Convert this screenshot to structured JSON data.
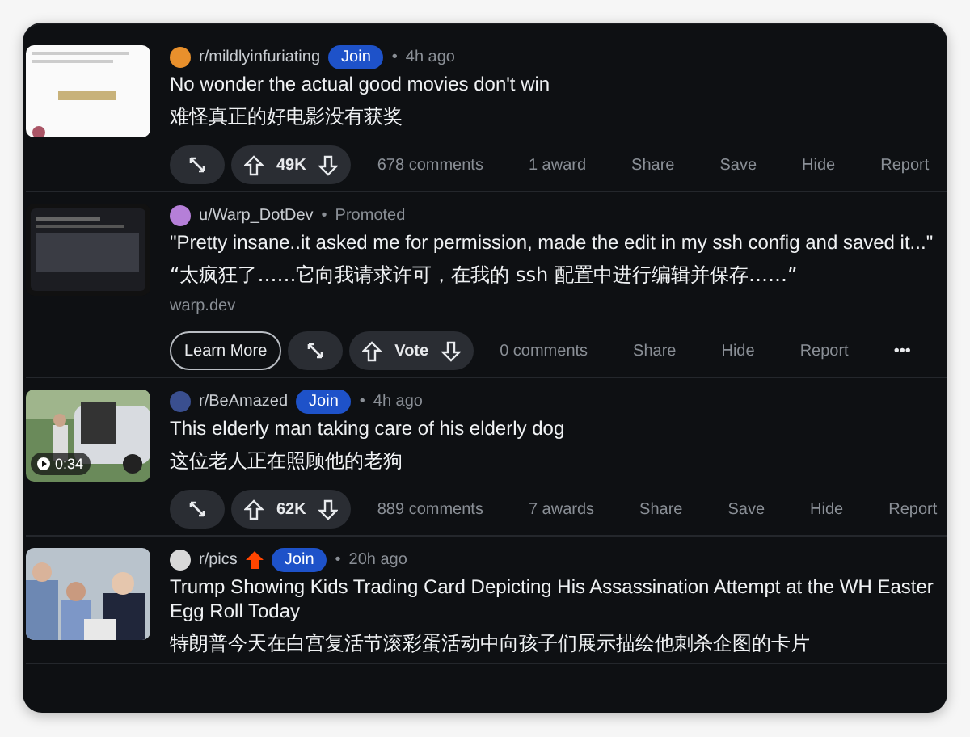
{
  "posts": [
    {
      "community": "r/mildlyinfuriating",
      "color": "#e8902c",
      "hot": false,
      "join": "Join",
      "separator": "•",
      "time": "4h ago",
      "title": "No wonder the actual good movies don't win",
      "translation": "难怪真正的好电影没有获奖",
      "actions": {
        "score": "49K",
        "comments": "678 comments",
        "awards": "1 award",
        "share": "Share",
        "save": "Save",
        "hide": "Hide",
        "report": "Report"
      }
    },
    {
      "community": "u/Warp_DotDev",
      "color": "#b57fd8",
      "hot": false,
      "separator": "•",
      "promoted": "Promoted",
      "title": "\"Pretty insane..it asked me for permission, made the edit in my ssh config and saved it...\"",
      "translation": "“太疯狂了……它向我请求许可，在我的 ssh 配置中进行编辑并保存……”",
      "domain": "warp.dev",
      "actions": {
        "learn_more": "Learn More",
        "score": "Vote",
        "comments": "0 comments",
        "share": "Share",
        "hide": "Hide",
        "report": "Report",
        "more": "•••"
      }
    },
    {
      "community": "r/BeAmazed",
      "color": "#3a4f8f",
      "hot": false,
      "join": "Join",
      "separator": "•",
      "time": "4h ago",
      "title": "This elderly man taking care of his elderly dog",
      "translation": "这位老人正在照顾他的老狗",
      "thumbnail": {
        "kind": "picture",
        "duration": "0:34"
      },
      "actions": {
        "score": "62K",
        "comments": "889 comments",
        "awards": "7 awards",
        "share": "Share",
        "save": "Save",
        "hide": "Hide",
        "report": "Report"
      }
    },
    {
      "community": "r/pics",
      "color": "#d8d8d8",
      "hot": true,
      "join": "Join",
      "separator": "•",
      "time": "20h ago",
      "title": "Trump Showing Kids Trading Card Depicting His Assassination Attempt at the WH Easter Egg Roll Today",
      "translation": "特朗普今天在白宫复活节滚彩蛋活动中向孩子们展示描绘他刺杀企图的卡片"
    }
  ]
}
